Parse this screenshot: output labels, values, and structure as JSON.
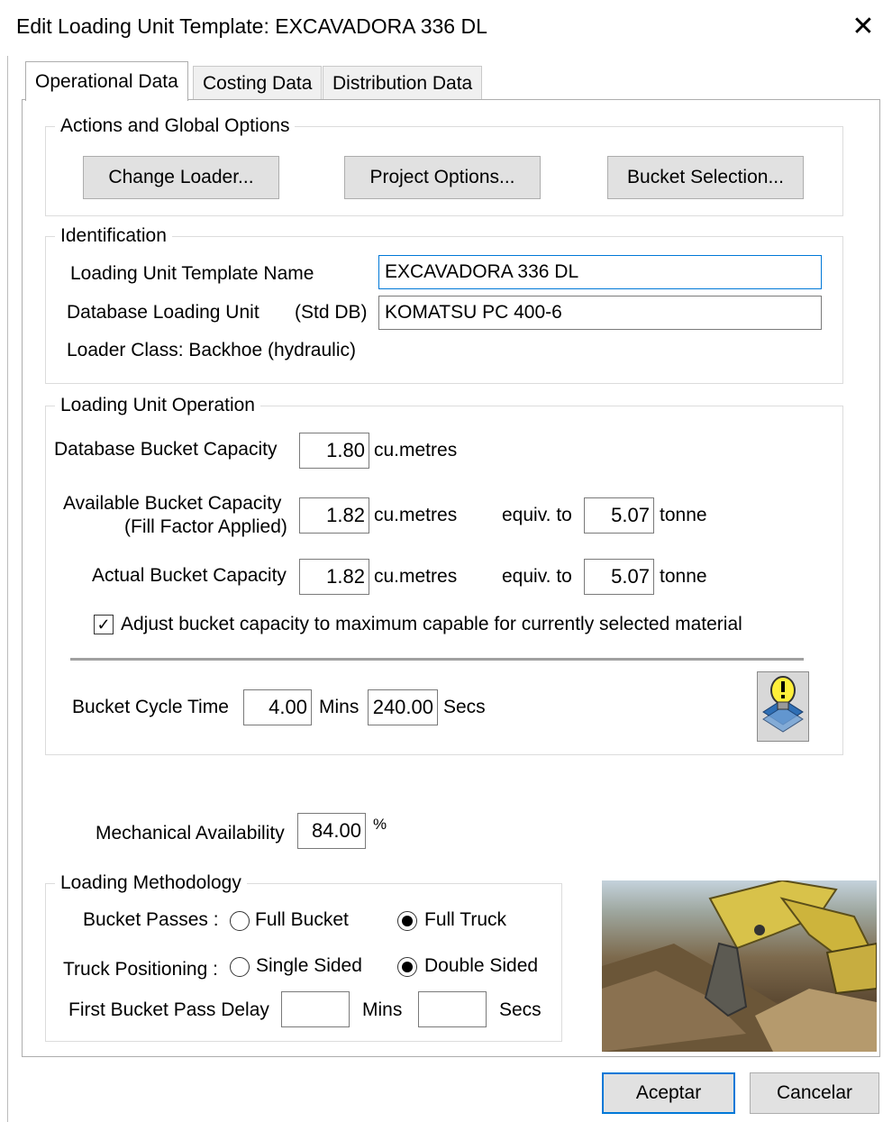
{
  "window": {
    "title": "Edit Loading Unit Template: EXCAVADORA 336 DL",
    "close": "✕"
  },
  "tabs": [
    {
      "label": "Operational Data",
      "active": true
    },
    {
      "label": "Costing Data",
      "active": false
    },
    {
      "label": "Distribution Data",
      "active": false
    }
  ],
  "actions": {
    "legend": "Actions and Global Options",
    "change_loader": "Change Loader...",
    "project_options": "Project Options...",
    "bucket_selection": "Bucket Selection..."
  },
  "identification": {
    "legend": "Identification",
    "template_name_label": "Loading Unit Template Name",
    "template_name_value": "EXCAVADORA 336 DL",
    "db_unit_label": "Database Loading Unit",
    "db_unit_suffix": "(Std DB)",
    "db_unit_value": "KOMATSU PC 400-6",
    "loader_class": "Loader Class: Backhoe (hydraulic)"
  },
  "operation": {
    "legend": "Loading Unit Operation",
    "db_capacity_label": "Database Bucket Capacity",
    "db_capacity_value": "1.80",
    "unit_m3": "cu.metres",
    "available_label_1": "Available Bucket Capacity",
    "available_label_2": "(Fill Factor Applied)",
    "available_value": "1.82",
    "equiv_to": "equiv. to",
    "available_tonne": "5.07",
    "unit_tonne": "tonne",
    "actual_label": "Actual Bucket Capacity",
    "actual_value": "1.82",
    "actual_tonne": "5.07",
    "adjust_checked": true,
    "adjust_label": "Adjust bucket capacity to maximum capable for currently selected material",
    "cycle_label": "Bucket Cycle Time",
    "cycle_mins": "4.00",
    "mins_label": "Mins",
    "cycle_secs": "240.00",
    "secs_label": "Secs"
  },
  "availability": {
    "label": "Mechanical Availability",
    "value": "84.00",
    "unit": "%"
  },
  "methodology": {
    "legend": "Loading Methodology",
    "passes_label": "Bucket Passes :",
    "full_bucket": "Full Bucket",
    "full_truck": "Full Truck",
    "passes_selected": "Full Truck",
    "positioning_label": "Truck Positioning :",
    "single_sided": "Single Sided",
    "double_sided": "Double Sided",
    "positioning_selected": "Double Sided",
    "delay_label": "First Bucket Pass Delay",
    "delay_mins": "",
    "mins_label": "Mins",
    "delay_secs": "",
    "secs_label": "Secs"
  },
  "footer": {
    "ok": "Aceptar",
    "cancel": "Cancelar"
  },
  "icons": {
    "hint": "lightbulb-exclamation-icon"
  }
}
